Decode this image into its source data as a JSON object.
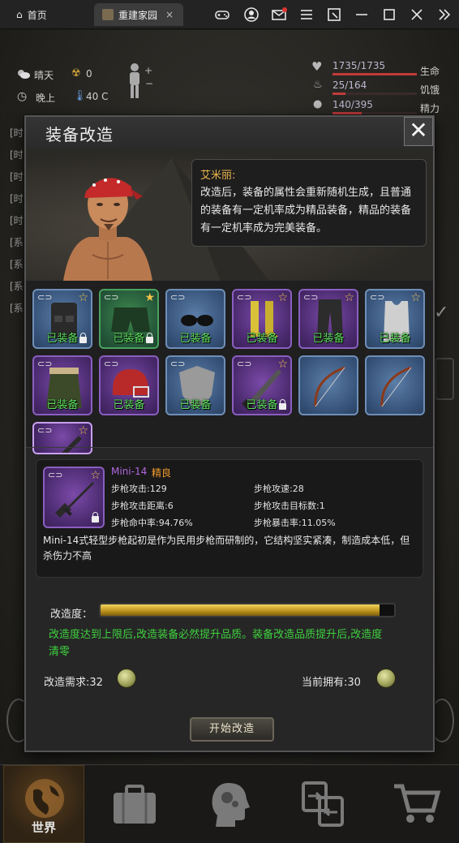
{
  "window": {
    "tabs": [
      {
        "label": "首页"
      },
      {
        "label": "重建家园"
      }
    ]
  },
  "hud": {
    "weather": "晴天",
    "radiation": "0",
    "time_of_day": "晚上",
    "temperature": "40 C",
    "stats": [
      {
        "value": "1735/1735",
        "label": "生命",
        "fraction": 1.0,
        "color": "#c23a3a"
      },
      {
        "value": "25/164",
        "label": "饥饿",
        "fraction": 0.15,
        "color": "#c23a3a"
      },
      {
        "value": "140/395",
        "label": "精力",
        "fraction": 0.35,
        "color": "#c23a3a"
      }
    ],
    "log_prefixes": [
      "[时",
      "[时",
      "[时",
      "[时",
      "[时",
      "[系",
      "[系",
      "[系",
      "[系"
    ]
  },
  "modal": {
    "title": "装备改造",
    "close_glyph": "✕",
    "speaker": "艾米丽:",
    "speech": "改造后，装备的属性会重新随机生成，且普通的装备有一定机率成为精品装备，精品的装备有一定机率成为完美装备。",
    "equipped_label": "已装备",
    "slots": [
      {
        "item": "tactical-vest",
        "rarity": "blue",
        "equipped": true,
        "star": true,
        "locked": true
      },
      {
        "item": "green-shorts",
        "rarity": "green",
        "equipped": true,
        "star": true,
        "star_filled": true,
        "locked": true
      },
      {
        "item": "sunglasses",
        "rarity": "blue",
        "equipped": true,
        "star": false,
        "locked": false
      },
      {
        "item": "yellow-boots",
        "rarity": "purple",
        "equipped": true,
        "star": true,
        "locked": false
      },
      {
        "item": "cargo-pants",
        "rarity": "purple",
        "equipped": true,
        "star": true,
        "locked": false
      },
      {
        "item": "tank-top",
        "rarity": "blue",
        "equipped": true,
        "star": true,
        "locked": false
      },
      {
        "item": "parka-jacket",
        "rarity": "purple",
        "equipped": true,
        "star": false,
        "locked": false
      },
      {
        "item": "football-helmet",
        "rarity": "purple",
        "equipped": true,
        "star": false,
        "locked": false
      },
      {
        "item": "riot-shield",
        "rarity": "blue",
        "equipped": true,
        "star": false,
        "locked": false
      },
      {
        "item": "machete",
        "rarity": "purple",
        "equipped": true,
        "star": true,
        "locked": true
      },
      {
        "item": "bow",
        "rarity": "blue",
        "equipped": false,
        "star": false,
        "locked": false
      },
      {
        "item": "bow",
        "rarity": "blue",
        "equipped": false,
        "star": false,
        "locked": false
      },
      {
        "item": "rifle",
        "rarity": "purple",
        "equipped": false,
        "star": true,
        "locked": false,
        "selected": true
      }
    ],
    "detail": {
      "name": "Mini-14",
      "quality": "精良",
      "stats": [
        {
          "label": "步枪攻击:",
          "value": "129"
        },
        {
          "label": "步枪攻速:",
          "value": "28"
        },
        {
          "label": "步枪攻击距离:",
          "value": "6"
        },
        {
          "label": "步枪攻击目标数:",
          "value": "1"
        },
        {
          "label": "步枪命中率:",
          "value": "94.76%"
        },
        {
          "label": "步枪暴击率:",
          "value": "11.05%"
        }
      ],
      "description": "Mini-14式轻型步枪起初是作为民用步枪而研制的，它结构坚实紧凑，制造成本低，但杀伤力不高"
    },
    "progress": {
      "label": "改造度：",
      "fraction": 0.95,
      "note": "改造度达到上限后,改造装备必然提升品质。装备改造品质提升后,改造度清零"
    },
    "requirement": {
      "label": "改造需求:",
      "value": "32"
    },
    "owned": {
      "label": "当前拥有:",
      "value": "30"
    },
    "start_button": "开始改造"
  },
  "bottom_nav": [
    {
      "label": "世界",
      "icon": "globe-icon",
      "active": true
    },
    {
      "label": "",
      "icon": "briefcase-icon"
    },
    {
      "label": "",
      "icon": "head-gears-icon"
    },
    {
      "label": "",
      "icon": "trade-icon"
    },
    {
      "label": "",
      "icon": "cart-icon"
    }
  ]
}
